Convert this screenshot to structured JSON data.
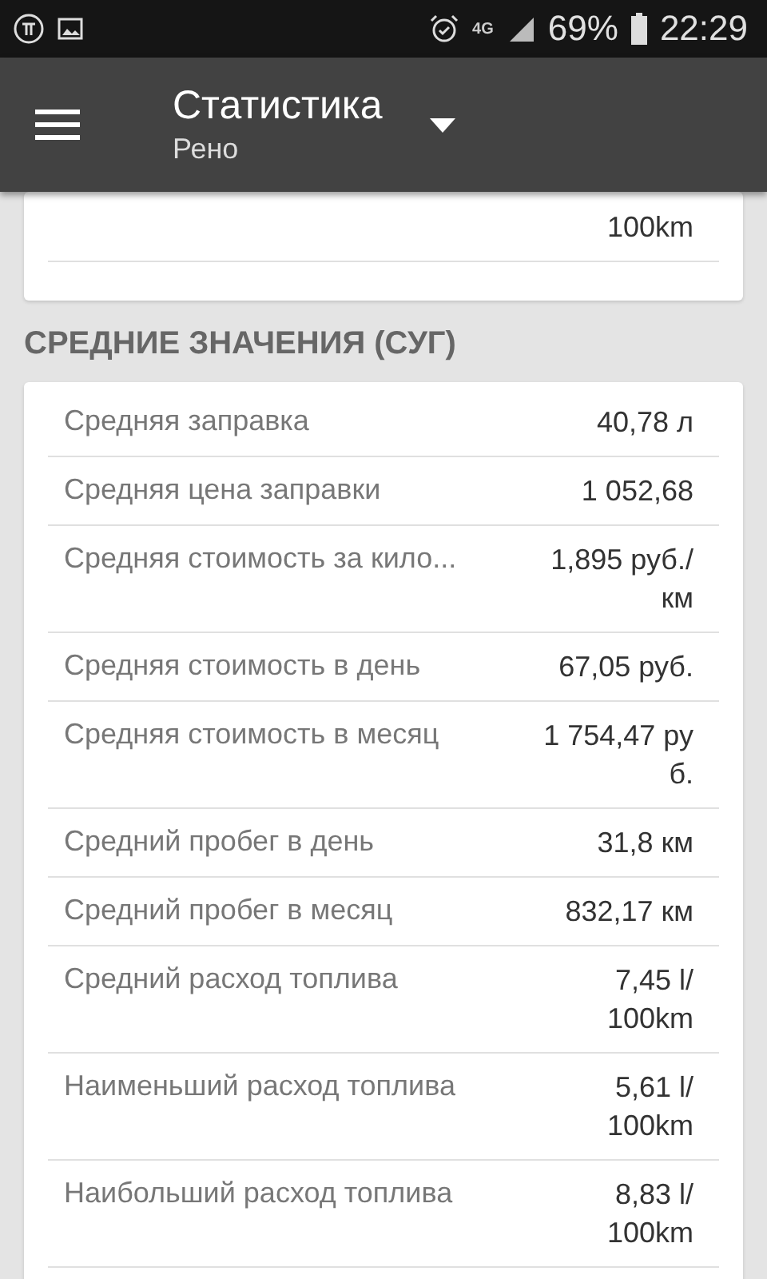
{
  "status_bar": {
    "time": "22:29",
    "battery": "69%",
    "network": "4G"
  },
  "app_bar": {
    "title": "Статистика",
    "subtitle": "Рено"
  },
  "sections": [
    {
      "rows": [
        {
          "value": [
            "100km"
          ]
        }
      ]
    },
    {
      "heading": "СРЕДНИЕ ЗНАЧЕНИЯ (СУГ)",
      "rows": [
        {
          "label": "Средняя заправка",
          "value": [
            "40,78 л"
          ]
        },
        {
          "label": "Средняя цена заправки",
          "value": [
            "1 052,68"
          ]
        },
        {
          "label": "Средняя стоимость за кило...",
          "value": [
            "1,895 руб./",
            "км"
          ]
        },
        {
          "label": "Средняя стоимость в день",
          "value": [
            "67,05 руб."
          ]
        },
        {
          "label": "Средняя стоимость в месяц",
          "value": [
            "1 754,47 ру",
            "б."
          ]
        },
        {
          "label": "Средний пробег в день",
          "value": [
            "31,8 км"
          ]
        },
        {
          "label": "Средний пробег в месяц",
          "value": [
            "832,17 км"
          ]
        },
        {
          "label": "Средний расход топлива",
          "value": [
            "7,45 l/",
            "100km"
          ]
        },
        {
          "label": "Наименьший расход топлива",
          "value": [
            "5,61 l/",
            "100km"
          ]
        },
        {
          "label": "Наибольший расход топлива",
          "value": [
            "8,83 l/",
            "100km"
          ]
        }
      ]
    }
  ]
}
